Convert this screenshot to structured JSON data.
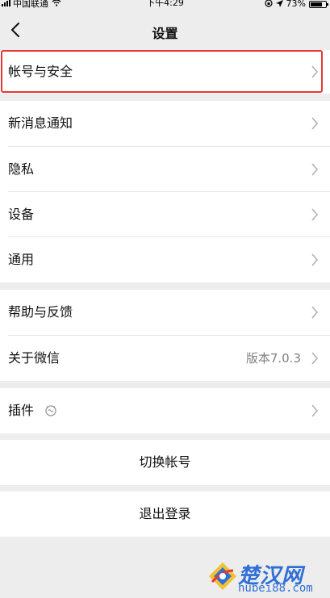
{
  "status_bar": {
    "carrier": "中国联通",
    "time": "下午4:29",
    "battery": "73%"
  },
  "nav": {
    "title": "设置"
  },
  "settings": {
    "account_security": "帐号与安全",
    "new_message_notifications": "新消息通知",
    "privacy": "隐私",
    "devices": "设备",
    "general": "通用",
    "help_feedback": "帮助与反馈",
    "about_wechat": "关于微信",
    "version": "版本7.0.3",
    "plugins": "插件"
  },
  "actions": {
    "switch_account": "切换帐号",
    "logout": "退出登录"
  },
  "watermark": {
    "brand": "楚汉网",
    "domain": "hubei88.com"
  },
  "colors": {
    "highlight": "#e53935",
    "background": "#ededed",
    "watermark": "#2f6fd6"
  }
}
